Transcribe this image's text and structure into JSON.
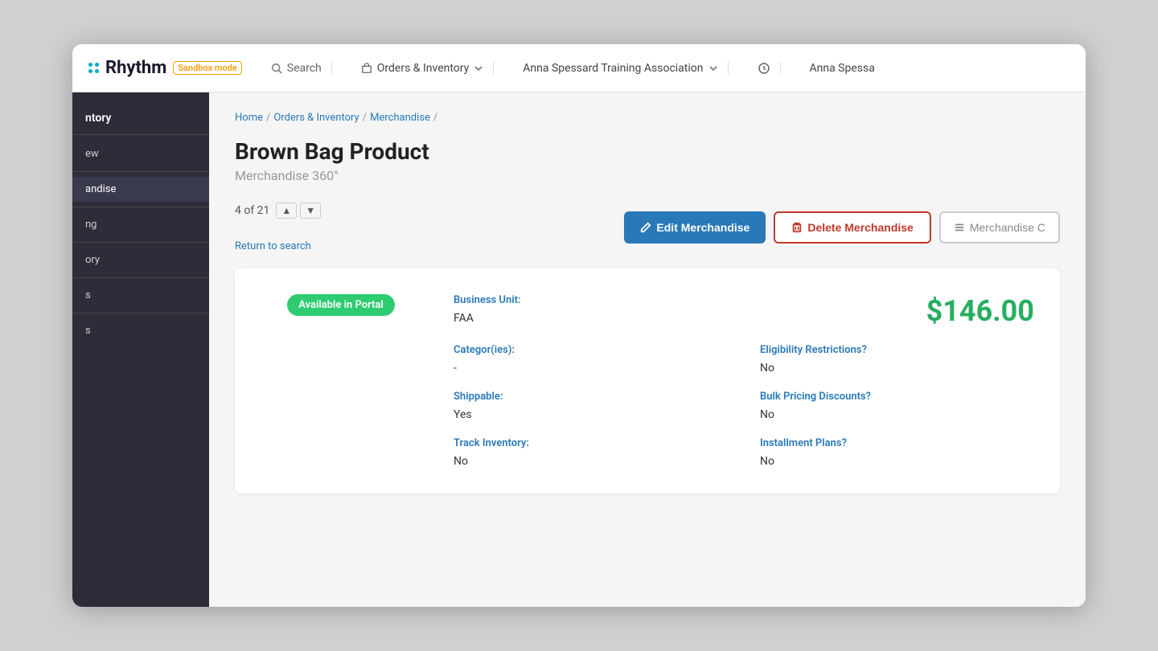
{
  "app": {
    "logo": "Rhythm",
    "sandbox_label": "Sandbox mode"
  },
  "header": {
    "search_label": "Search",
    "nav_orders": "Orders & Inventory",
    "org_name": "Anna Spessard Training Association",
    "user_name": "Anna Spessa"
  },
  "sidebar": {
    "section_title": "ntory",
    "items": [
      {
        "label": "ew",
        "active": false
      },
      {
        "label": "andise",
        "active": true
      },
      {
        "label": "ng",
        "active": false
      },
      {
        "label": "ory",
        "active": false
      },
      {
        "label": "s",
        "active": false
      },
      {
        "label": "s",
        "active": false
      }
    ]
  },
  "breadcrumb": {
    "items": [
      "Home",
      "Orders & Inventory",
      "Merchandise",
      ""
    ]
  },
  "product": {
    "title": "Brown Bag Product",
    "subtitle": "Merchandise 360°",
    "pagination": "4 of 21",
    "return_search": "Return to search",
    "edit_label": "Edit Merchandise",
    "delete_label": "Delete Merchandise",
    "more_label": "Merchandise C",
    "availability_badge": "Available in Portal",
    "price": "$146.00",
    "fields": {
      "business_unit_label": "Business Unit:",
      "business_unit_value": "FAA",
      "categories_label": "Categor(ies):",
      "categories_value": "-",
      "shippable_label": "Shippable:",
      "shippable_value": "Yes",
      "track_inventory_label": "Track Inventory:",
      "track_inventory_value": "No",
      "eligibility_label": "Eligibility Restrictions?",
      "eligibility_value": "No",
      "bulk_pricing_label": "Bulk Pricing Discounts?",
      "bulk_pricing_value": "No",
      "installment_label": "Installment Plans?",
      "installment_value": "No"
    }
  }
}
